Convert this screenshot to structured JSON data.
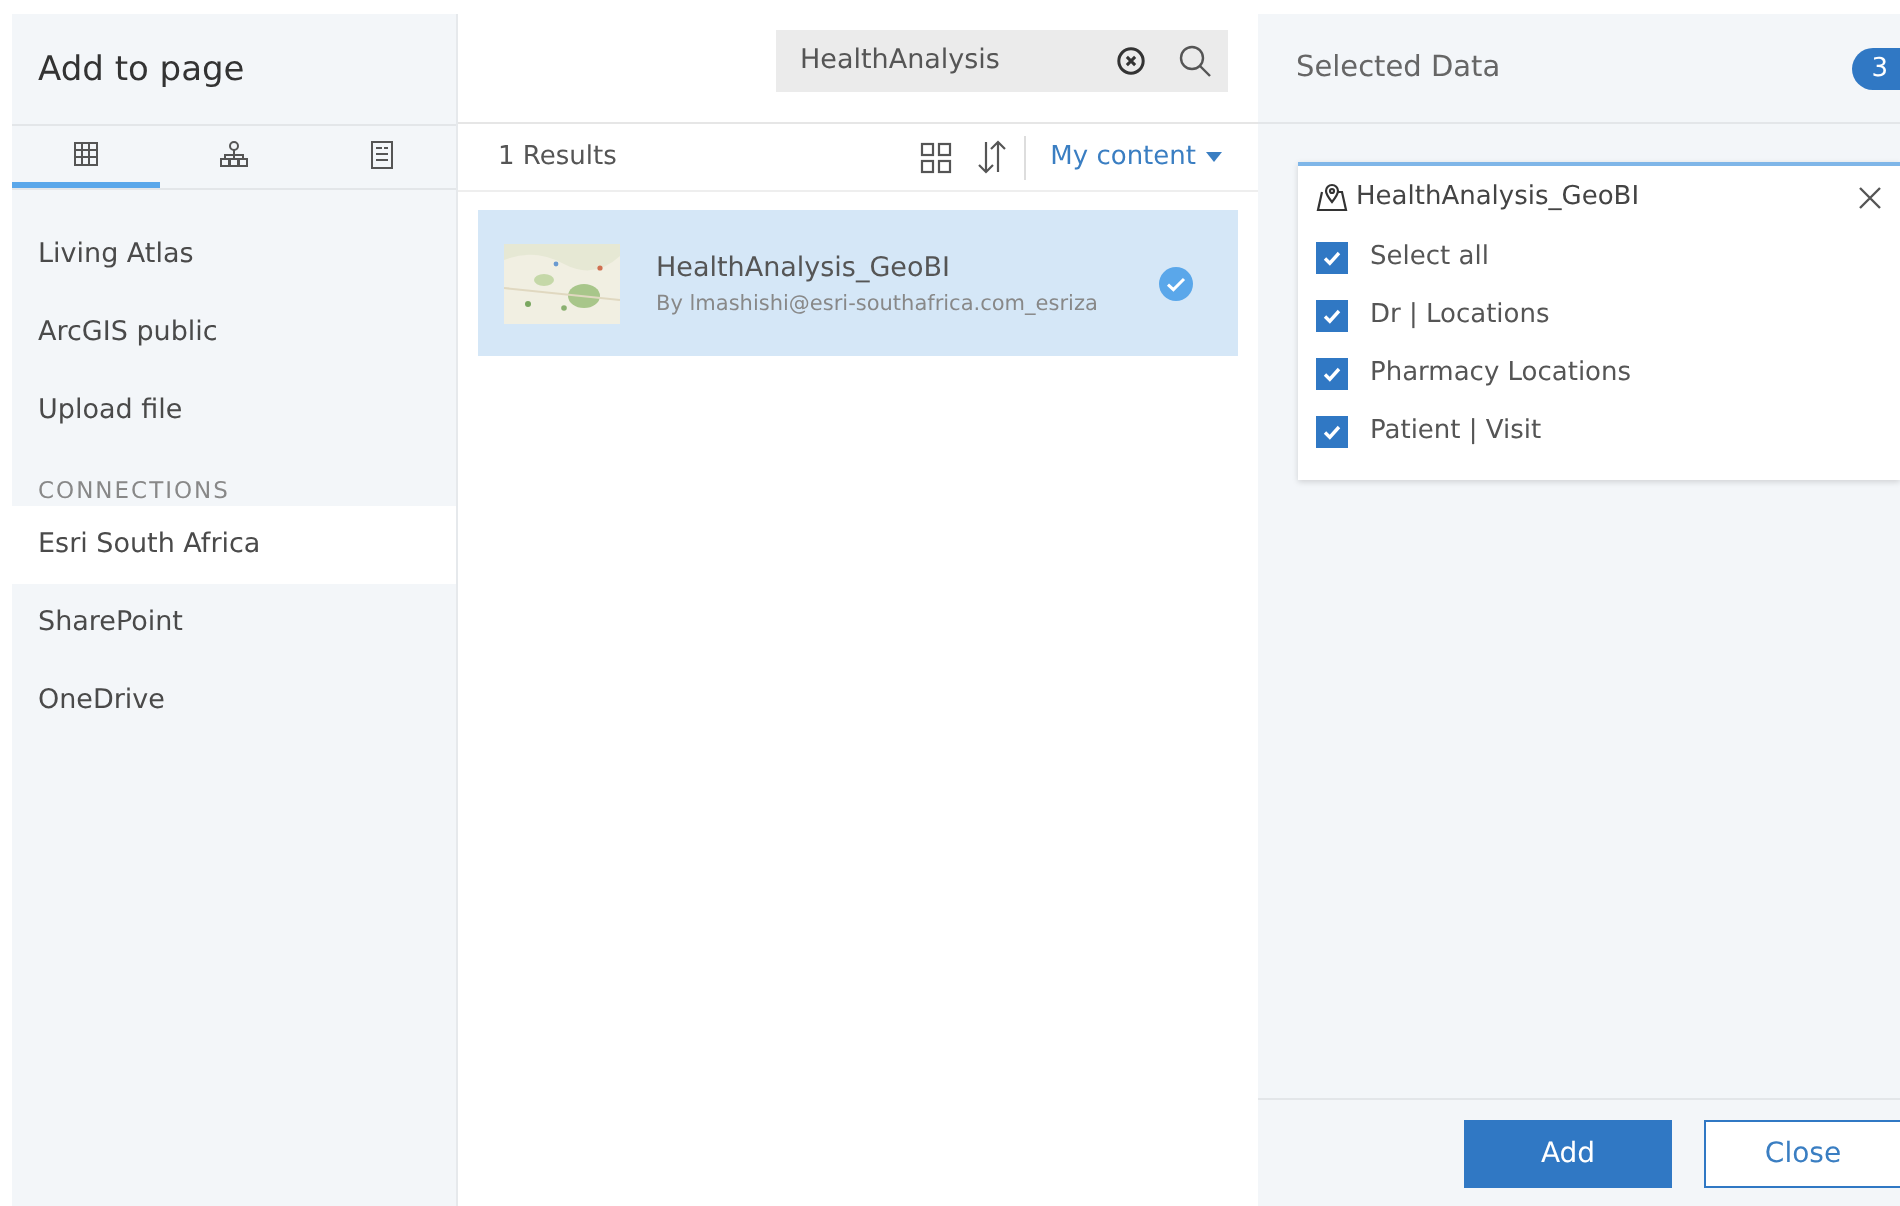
{
  "sidebar": {
    "title": "Add to page",
    "tabs": [
      {
        "selected": true
      },
      {
        "selected": false
      },
      {
        "selected": false
      }
    ],
    "items": [
      {
        "kind": "item",
        "label": "Living Atlas",
        "selected": false
      },
      {
        "kind": "item",
        "label": "ArcGIS public",
        "selected": false
      },
      {
        "kind": "item",
        "label": "Upload file",
        "selected": false
      },
      {
        "kind": "section",
        "label": "CONNECTIONS"
      },
      {
        "kind": "item",
        "label": "Esri South Africa",
        "selected": true
      },
      {
        "kind": "item",
        "label": "SharePoint",
        "selected": false
      },
      {
        "kind": "item",
        "label": "OneDrive",
        "selected": false
      }
    ]
  },
  "search": {
    "value": "HealthAnalysis"
  },
  "results": {
    "count": "1 Results",
    "filter": "My content",
    "items": [
      {
        "title": "HealthAnalysis_GeoBI",
        "owner": "By lmashishi@esri-southafrica.com_esriza",
        "selected": true
      }
    ]
  },
  "selected_panel": {
    "title": "Selected Data",
    "count": "3",
    "layer": {
      "name": "HealthAnalysis_GeoBI",
      "options": [
        {
          "label": "Select all",
          "checked": true
        },
        {
          "label": "Dr | Locations",
          "checked": true
        },
        {
          "label": "Pharmacy Locations",
          "checked": true
        },
        {
          "label": "Patient | Visit",
          "checked": true
        }
      ]
    }
  },
  "buttons": [
    {
      "kind": "primary",
      "label": "Add"
    },
    {
      "kind": "secondary",
      "label": "Close"
    }
  ]
}
